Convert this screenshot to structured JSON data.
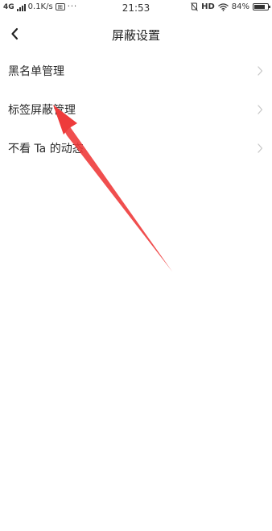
{
  "status_bar": {
    "network": "4G",
    "speed": "0.1K/s",
    "app_icon_label": "图",
    "more": "···",
    "time": "21:53",
    "hd": "HD",
    "battery": "84%",
    "battery_level": 0.84
  },
  "nav": {
    "title": "屏蔽设置"
  },
  "list": [
    {
      "label": "黑名单管理"
    },
    {
      "label": "标签屏蔽管理"
    },
    {
      "label": "不看 Ta 的动态"
    }
  ],
  "colors": {
    "arrow": "#ee3b3b",
    "chevron": "#c8c8c8",
    "text": "#2a2a2a"
  }
}
